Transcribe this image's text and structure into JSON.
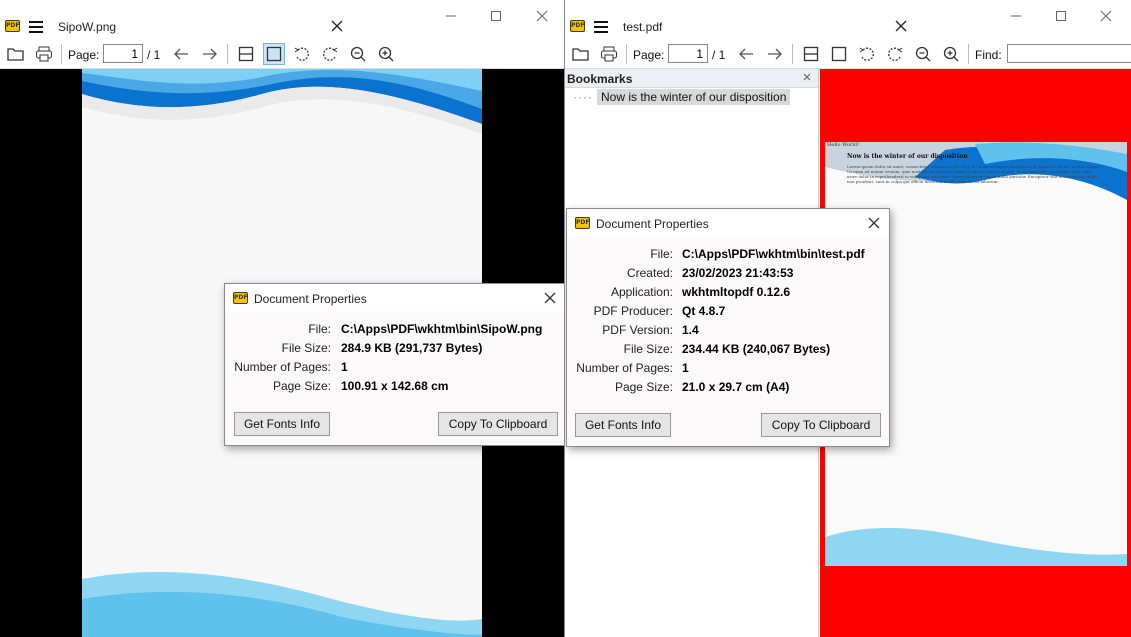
{
  "left_window": {
    "title": "SipoW.png",
    "toolbar": {
      "page_label": "Page:",
      "page_value": "1",
      "page_total": "/ 1"
    },
    "dialog": {
      "title": "Document Properties",
      "rows": [
        {
          "key": "File:",
          "value": "C:\\Apps\\PDF\\wkhtm\\bin\\SipoW.png"
        },
        {
          "key": "File Size:",
          "value": "284.9 KB (291,737 Bytes)"
        },
        {
          "key": "Number of Pages:",
          "value": "1"
        },
        {
          "key": "Page Size:",
          "value": "100.91 x 142.68 cm"
        }
      ],
      "fonts_button": "Get Fonts Info",
      "copy_button": "Copy To Clipboard"
    }
  },
  "right_window": {
    "title": "test.pdf",
    "toolbar": {
      "page_label": "Page:",
      "page_value": "1",
      "page_total": "/ 1",
      "find_label": "Find:",
      "find_value": ""
    },
    "bookmarks": {
      "header": "Bookmarks",
      "items": [
        {
          "label": "Now is the winter of our disposition"
        }
      ]
    },
    "page_preview": {
      "name": "Hello World!",
      "heading": "Now is the winter of our disposition",
      "paragraph": "Lorem ipsum dolor sit amet, consectetur adipiscing elit, sed do eiusmod tempor incididunt ut labore et dolore magna aliqua. Ut enim ad minim veniam, quis nostrud exercitation ullamco laboris nisi ut aliquip ex ea commodo consequat. Duis aute irure dolor in reprehenderit in voluptate velit esse cillum dolore eu fugiat nulla pariatur. Excepteur sint occaecat cupidatat non proident, sunt in culpa qui officia deserunt mollit anim id est laborum."
    },
    "dialog": {
      "title": "Document Properties",
      "rows": [
        {
          "key": "File:",
          "value": "C:\\Apps\\PDF\\wkhtm\\bin\\test.pdf"
        },
        {
          "key": "Created:",
          "value": "23/02/2023 21:43:53"
        },
        {
          "key": "Application:",
          "value": "wkhtmltopdf 0.12.6"
        },
        {
          "key": "PDF Producer:",
          "value": "Qt 4.8.7"
        },
        {
          "key": "PDF Version:",
          "value": "1.4"
        },
        {
          "key": "File Size:",
          "value": "234.44 KB (240,067 Bytes)"
        },
        {
          "key": "Number of Pages:",
          "value": "1"
        },
        {
          "key": "Page Size:",
          "value": "21.0 x 29.7 cm (A4)"
        }
      ],
      "fonts_button": "Get Fonts Info",
      "copy_button": "Copy To Clipboard"
    }
  },
  "icons": {
    "app_logo": "PDF",
    "tools": [
      "folder-open-icon",
      "print-icon",
      "arrow-left-icon",
      "arrow-right-icon",
      "continuous-view-icon",
      "single-page-icon",
      "rotate-left-icon",
      "rotate-right-icon",
      "zoom-out-icon",
      "zoom-in-icon"
    ]
  },
  "colors": {
    "viewer_background_left": "#000000",
    "viewer_background_right": "#ff0000",
    "wave_dark": "#0a73cf",
    "wave_light": "#61c3ec",
    "active_tool": "#cde4f7"
  }
}
